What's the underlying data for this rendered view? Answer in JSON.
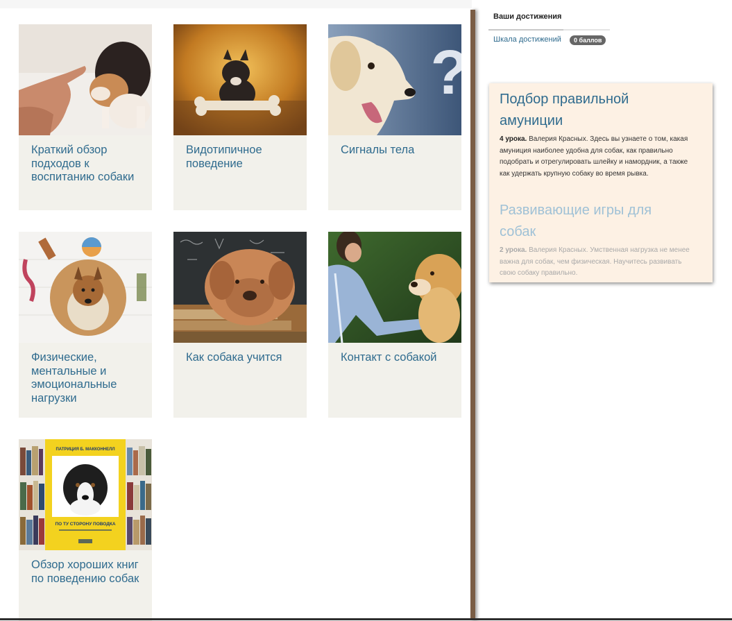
{
  "cards": [
    {
      "title": "Краткий обзор подходов к воспитанию собаки",
      "image": "puppy-beagle-finger-photo"
    },
    {
      "title": "Видотипичное поведение",
      "image": "french-bulldog-bone-photo"
    },
    {
      "title": "Сигналы тела",
      "image": "labrador-question-mark-photo"
    },
    {
      "title": "Физические, ментальные и эмоциональные нагрузки",
      "image": "sheltie-toys-photo"
    },
    {
      "title": "Как собака учится",
      "image": "mastiff-books-chalkboard-photo"
    },
    {
      "title": "Контакт с собакой",
      "image": "woman-golden-retriever-paw-photo"
    },
    {
      "title": "Обзор хороших книг по поведению собак",
      "image": "book-cover-bookshelf-photo"
    }
  ],
  "book_cover": {
    "author": "ПАТРИЦИЯ Б. МАККОННЕЛЛ",
    "title": "ПО ТУ СТОРОНУ ПОВОДКА"
  },
  "sidebar": {
    "achievements_tab": "Ваши достижения",
    "scale_link": "Шкала достижений",
    "points_badge": "0 баллов"
  },
  "courses": [
    {
      "title": "Подбор правильной амуниции",
      "lessons": "4 урока.",
      "description": " Валерия Красных. Здесь вы узнаете о том, какая амуниция наиболее удобна для собак, как правильно подобрать и отрегулировать шлейку и намордник, а также как удержать крупную собаку во время рывка."
    },
    {
      "title": "Развивающие игры для собак",
      "lessons": "2 урока.",
      "description": " Валерия Красных. Умственная нагрузка не менее важна для собак, чем физическая. Научитесь развивать свою собаку правильно."
    }
  ],
  "colors": {
    "accent": "#2f6b8e",
    "card_bg": "#f2f1eb",
    "panel_bg": "#fdf1e4",
    "divider": "#7a5d45"
  }
}
